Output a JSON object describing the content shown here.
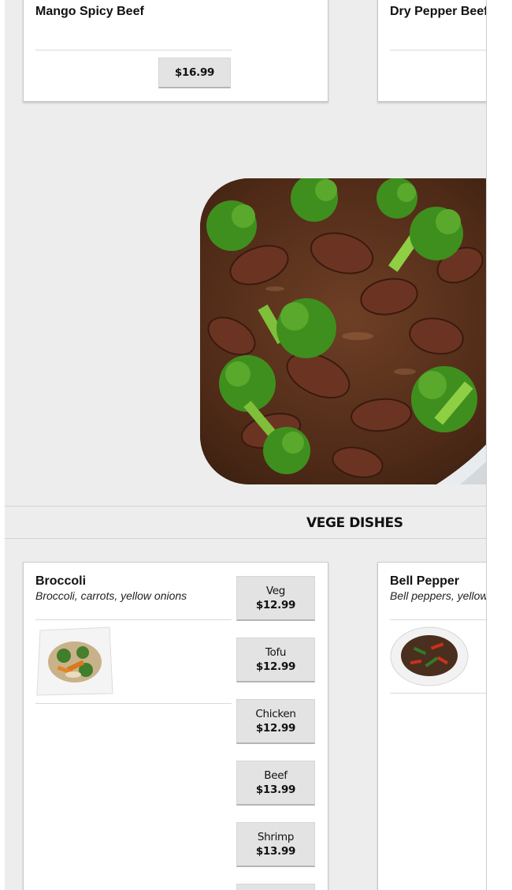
{
  "top_cards": [
    {
      "name": "Mango Spicy Beef",
      "price": "$16.99"
    },
    {
      "name": "Dry Pepper Beef"
    }
  ],
  "hero_image": {
    "alt": "beef-broccoli-dish"
  },
  "section": {
    "title": "VEGE DISHES"
  },
  "veg_cards": [
    {
      "name": "Broccoli",
      "description": "Broccoli, carrots, yellow onions",
      "options": [
        {
          "label": "Veg",
          "price": "$12.99"
        },
        {
          "label": "Tofu",
          "price": "$12.99"
        },
        {
          "label": "Chicken",
          "price": "$12.99"
        },
        {
          "label": "Beef",
          "price": "$13.99"
        },
        {
          "label": "Shrimp",
          "price": "$13.99"
        }
      ]
    },
    {
      "name": "Bell Pepper",
      "description": "Bell peppers, yellow"
    }
  ],
  "colors": {
    "page_bg": "#ededed",
    "card_bg": "#ffffff",
    "button_bg": "#e3e3e3",
    "sauce": "#5a3320",
    "broccoli": "#3f8f1e"
  }
}
